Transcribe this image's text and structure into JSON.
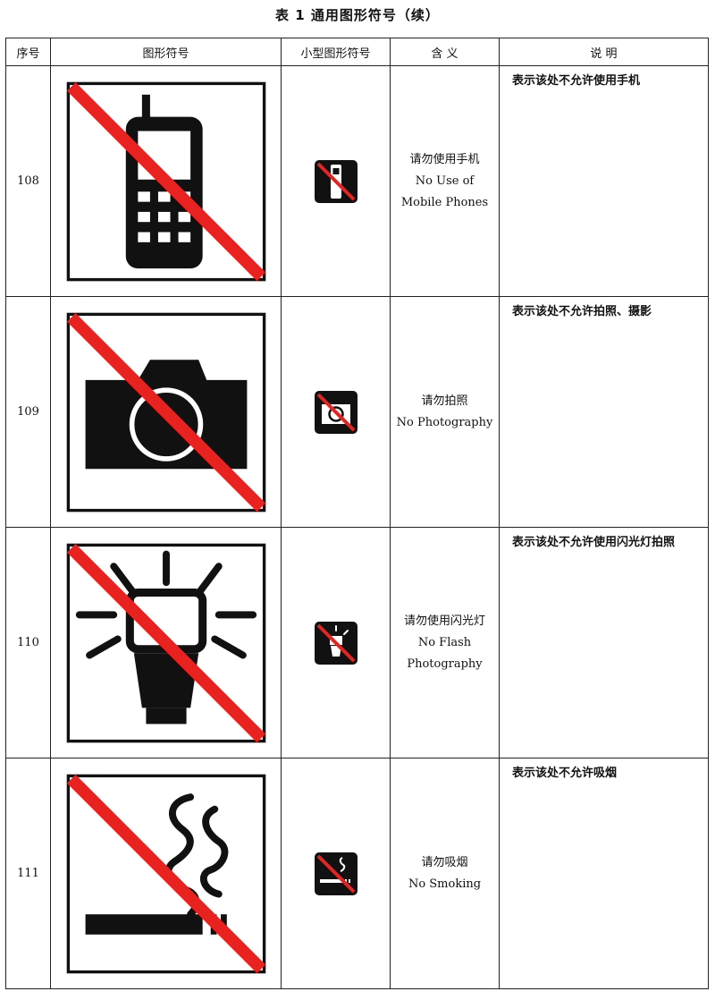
{
  "title": "表 1  通用图形符号（续）",
  "headers": {
    "num": "序号",
    "symbol": "图形符号",
    "small": "小型图形符号",
    "meaning": "含  义",
    "desc": "说  明"
  },
  "rows": [
    {
      "num": "108",
      "icon": "no-mobile-phone-icon",
      "meaning_zh": "请勿使用手机",
      "meaning_en_1": "No Use of",
      "meaning_en_2": "Mobile Phones",
      "desc": "表示该处不允许使用手机"
    },
    {
      "num": "109",
      "icon": "no-camera-icon",
      "meaning_zh": "请勿拍照",
      "meaning_en_1": "No Photography",
      "meaning_en_2": "",
      "desc": "表示该处不允许拍照、摄影"
    },
    {
      "num": "110",
      "icon": "no-flash-icon",
      "meaning_zh": "请勿使用闪光灯",
      "meaning_en_1": "No Flash",
      "meaning_en_2": "Photography",
      "desc": "表示该处不允许使用闪光灯拍照"
    },
    {
      "num": "111",
      "icon": "no-smoking-icon",
      "meaning_zh": "请勿吸烟",
      "meaning_en_1": "No Smoking",
      "meaning_en_2": "",
      "desc": "表示该处不允许吸烟"
    }
  ],
  "colors": {
    "prohibition": "#e8221f",
    "symbol": "#111111"
  }
}
